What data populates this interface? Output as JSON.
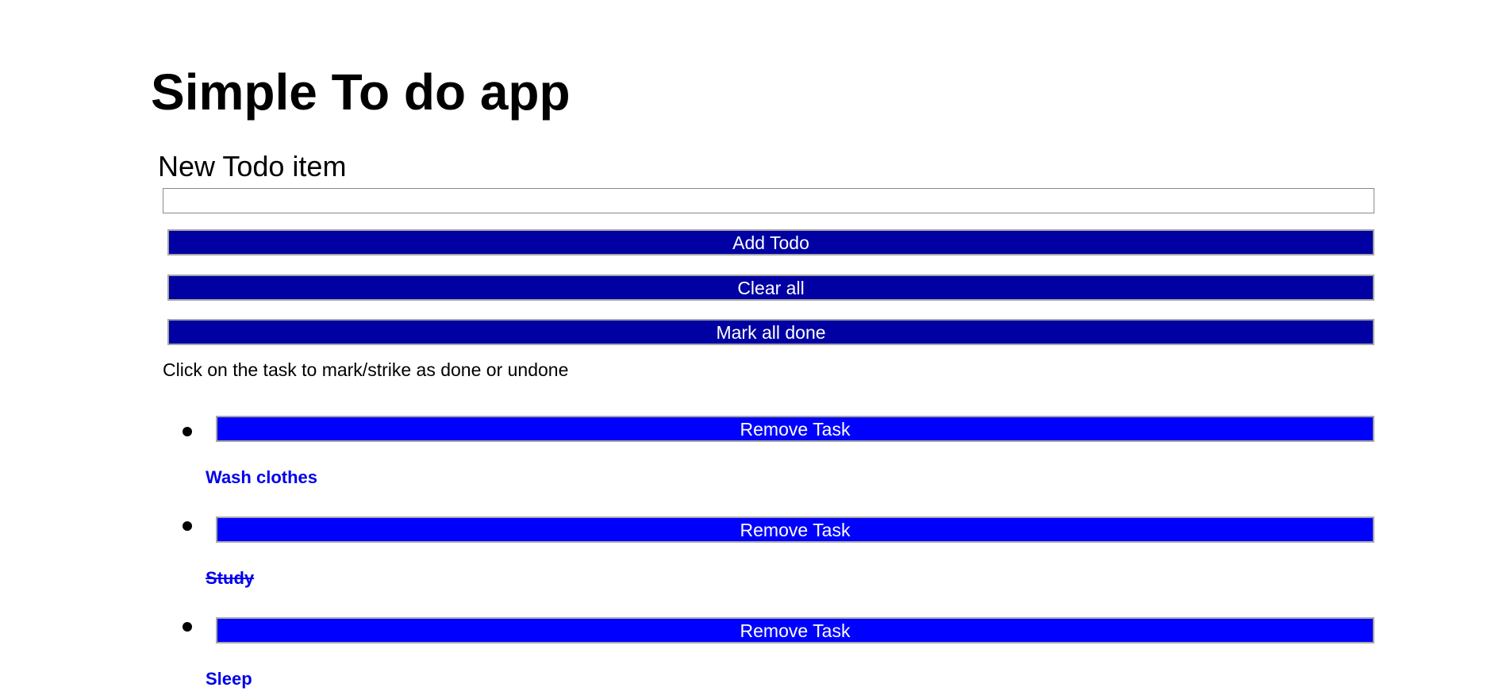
{
  "app": {
    "title": "Simple To do app"
  },
  "form": {
    "label": "New Todo item",
    "input_value": "",
    "input_placeholder": ""
  },
  "buttons": {
    "add": "Add Todo",
    "clear": "Clear all",
    "mark_all": "Mark all done"
  },
  "hint": "Click on the task to mark/strike as done or undone",
  "tasks": [
    {
      "name": "Wash clothes",
      "done": false,
      "remove_label": "Remove Task"
    },
    {
      "name": "Study",
      "done": true,
      "remove_label": "Remove Task"
    },
    {
      "name": "Sleep",
      "done": false,
      "remove_label": "Remove Task"
    }
  ],
  "colors": {
    "action_button": "#0000a3",
    "remove_button": "#0000ff",
    "task_text": "#0000ee"
  }
}
